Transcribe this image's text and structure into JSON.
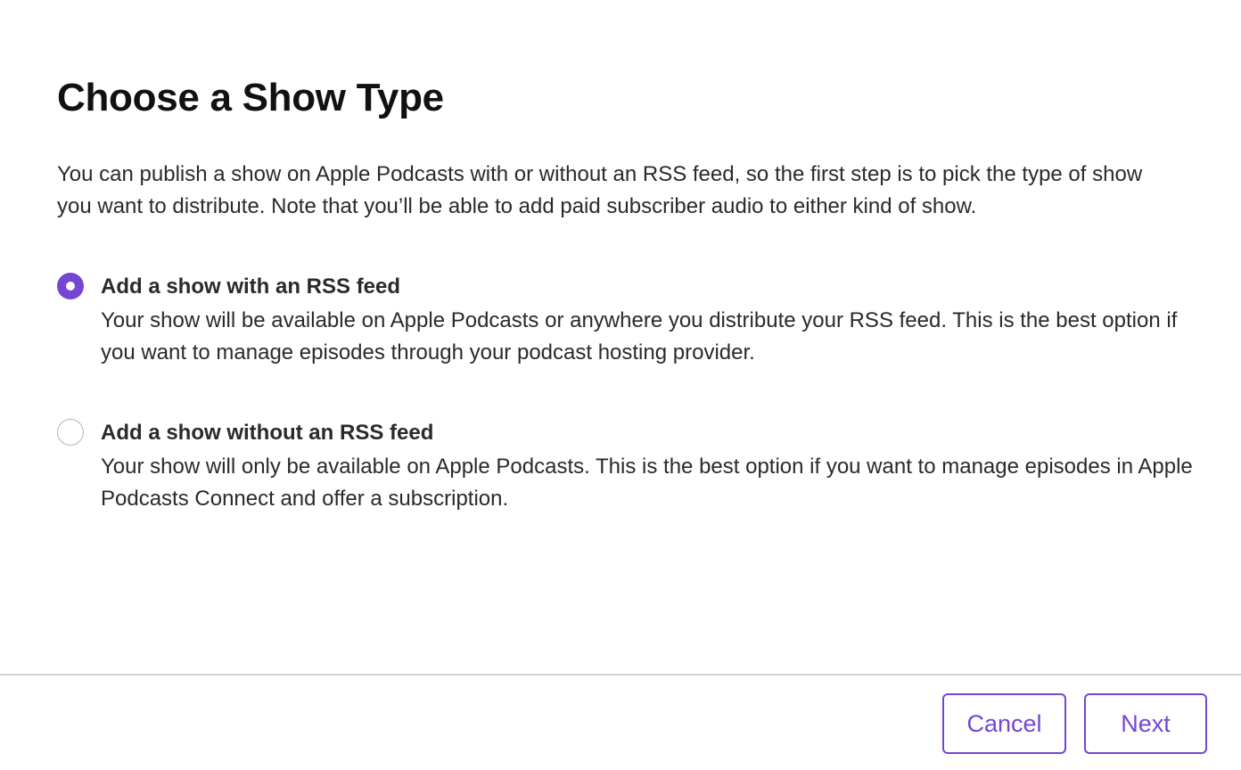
{
  "dialog": {
    "title": "Choose a Show Type",
    "intro": "You can publish a show on Apple Podcasts with or without an RSS feed, so the first step is to pick the type of show you want to distribute. Note that you’ll be able to add paid subscriber audio to either kind of show.",
    "options": [
      {
        "title": "Add a show with an RSS feed",
        "description": "Your show will be available on Apple Podcasts or anywhere you distribute your RSS feed. This is the best option if you want to manage episodes through your podcast hosting provider.",
        "selected": true
      },
      {
        "title": "Add a show without an RSS feed",
        "description": "Your show will only be available on Apple Podcasts. This is the best option if you want to manage episodes in Apple Podcasts Connect and offer a subscription.",
        "selected": false
      }
    ]
  },
  "footer": {
    "cancel_label": "Cancel",
    "next_label": "Next"
  },
  "colors": {
    "accent": "#7446d3",
    "text": "#2a2a2c",
    "divider": "#d2d2d7"
  }
}
